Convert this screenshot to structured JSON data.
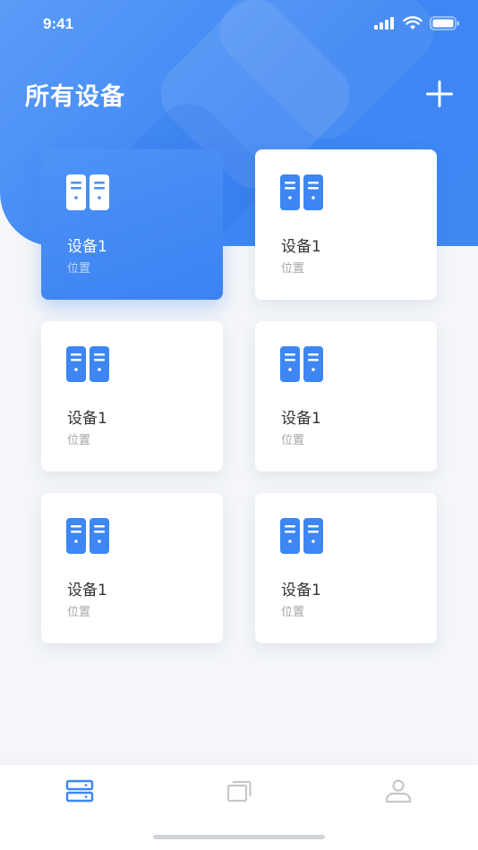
{
  "status_bar": {
    "time": "9:41",
    "icons": [
      "signal-icon",
      "wifi-icon",
      "battery-icon"
    ]
  },
  "header": {
    "title": "所有设备",
    "add_icon": "plus-icon"
  },
  "devices": [
    {
      "name": "设备1",
      "location": "位置",
      "icon": "server-icon",
      "selected": true
    },
    {
      "name": "设备1",
      "location": "位置",
      "icon": "server-icon",
      "selected": false
    },
    {
      "name": "设备1",
      "location": "位置",
      "icon": "server-icon",
      "selected": false
    },
    {
      "name": "设备1",
      "location": "位置",
      "icon": "server-icon",
      "selected": false
    },
    {
      "name": "设备1",
      "location": "位置",
      "icon": "server-icon",
      "selected": false
    },
    {
      "name": "设备1",
      "location": "位置",
      "icon": "server-icon",
      "selected": false
    }
  ],
  "tabbar": {
    "tabs": [
      {
        "icon": "devices-tab-icon",
        "active": true
      },
      {
        "icon": "windows-tab-icon",
        "active": false
      },
      {
        "icon": "profile-tab-icon",
        "active": false
      }
    ]
  },
  "colors": {
    "accent": "#3d86f3",
    "background": "#f4f6f9",
    "inactive_icon": "#c4c7cc"
  }
}
